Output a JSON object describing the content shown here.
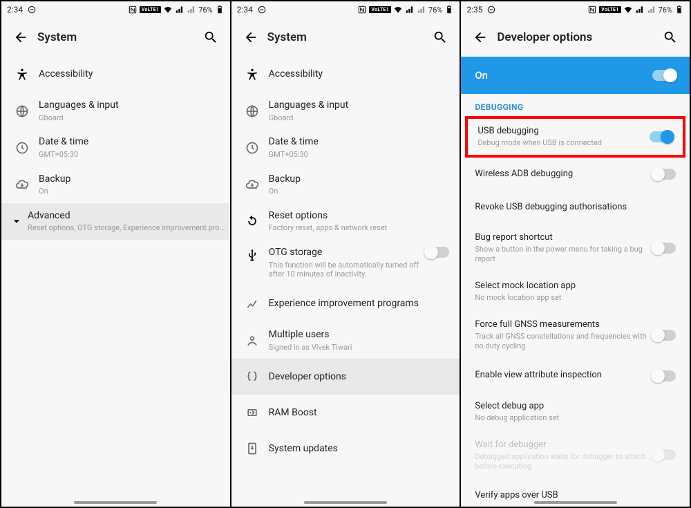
{
  "status": {
    "time_a": "2:34",
    "time_b": "2:34",
    "time_c": "2:35",
    "volte": "VoLTE1",
    "battery": "76%"
  },
  "screen1": {
    "title": "System",
    "accessibility": "Accessibility",
    "lang_title": "Languages & input",
    "lang_sub": "Gboard",
    "date_title": "Date & time",
    "date_sub": "GMT+05:30",
    "backup_title": "Backup",
    "backup_sub": "On",
    "adv_title": "Advanced",
    "adv_sub": "Reset options, OTG storage, Experience improvement pro…"
  },
  "screen2": {
    "title": "System",
    "accessibility": "Accessibility",
    "lang_title": "Languages & input",
    "lang_sub": "Gboard",
    "date_title": "Date & time",
    "date_sub": "GMT+05:30",
    "backup_title": "Backup",
    "backup_sub": "On",
    "reset_title": "Reset options",
    "reset_sub": "Factory reset, apps & network reset",
    "otg_title": "OTG storage",
    "otg_sub": "This function will be automatically turned off after 10 minutes of inactivity.",
    "exp_title": "Experience improvement programs",
    "multi_title": "Multiple users",
    "multi_sub": "Signed in as Vivek Tiwari",
    "dev_title": "Developer options",
    "ram_title": "RAM Boost",
    "sys_title": "System updates"
  },
  "screen3": {
    "title": "Developer options",
    "banner": "On",
    "section": "DEBUGGING",
    "usb_title": "USB debugging",
    "usb_sub": "Debug mode when USB is connected",
    "wadb": "Wireless ADB debugging",
    "revoke": "Revoke USB debugging authorisations",
    "bug_title": "Bug report shortcut",
    "bug_sub": "Show a button in the power menu for taking a bug report",
    "mock_title": "Select mock location app",
    "mock_sub": "No mock location app set",
    "gnss_title": "Force full GNSS measurements",
    "gnss_sub": "Track all GNSS constellations and frequencies with no duty cycling",
    "view_attr": "Enable view attribute inspection",
    "debug_app": "Select debug app",
    "debug_app_sub": "No debug application set",
    "wait_title": "Wait for debugger",
    "wait_sub": "Debugged application waits for debugger to attach before executing",
    "verify": "Verify apps over USB"
  }
}
